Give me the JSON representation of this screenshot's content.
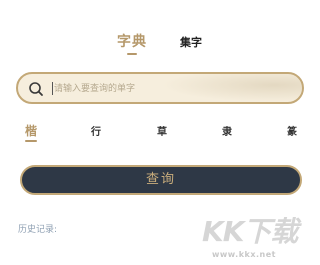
{
  "tabs": [
    {
      "label": "字典",
      "active": true
    },
    {
      "label": "集字",
      "active": false
    }
  ],
  "search": {
    "placeholder": "请输入要查询的单字",
    "value": ""
  },
  "styles": [
    {
      "label": "楷",
      "active": true
    },
    {
      "label": "行",
      "active": false
    },
    {
      "label": "草",
      "active": false
    },
    {
      "label": "隶",
      "active": false
    },
    {
      "label": "篆",
      "active": false
    }
  ],
  "query_button": {
    "label": "查询"
  },
  "history": {
    "label": "历史记录:"
  },
  "watermark": {
    "brand": "KK下载",
    "url": "www.kkx.net"
  },
  "colors": {
    "accent": "#b5986a",
    "button_bg": "#2e3846",
    "search_bg": "#f6eedd",
    "history_text": "#8fa0b3"
  },
  "icons": {
    "search": "search-icon"
  }
}
